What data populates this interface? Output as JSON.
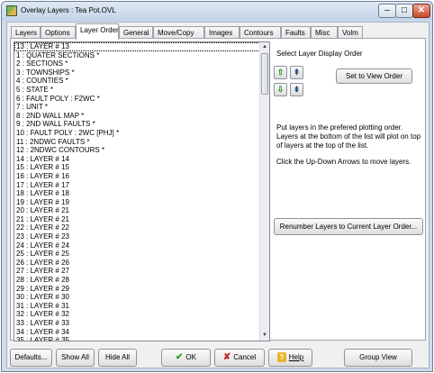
{
  "window": {
    "title": "Overlay Layers : Tea Pot.OVL",
    "minimize_glyph": "–",
    "maximize_glyph": "□",
    "close_glyph": "✕",
    "app_icon": "overlay-layers-icon"
  },
  "tabs": [
    "Layers",
    "Options",
    "Layer Order",
    "General",
    "Move/Copy",
    "Images",
    "Contours",
    "Faults",
    "Misc",
    "Volm"
  ],
  "active_tab": "Layer Order",
  "layer_list": {
    "items": [
      "13 : LAYER # 13",
      "1 : QUATER SECTIONS *",
      "2 : SECTIONS *",
      "3 : TOWNSHIPS *",
      "4 : COUNTIES *",
      "5 : STATE *",
      "6 : FAULT POLY : F2WC *",
      "7 : UNIT *",
      "8 : 2ND WALL MAP *",
      "9 : 2ND WALL FAULTS *",
      "10 : FAULT POLY : 2WC [PHJ] *",
      "11 : 2NDWC FAULTS *",
      "12 : 2NDWC CONTOURS *",
      "14 : LAYER # 14",
      "15 : LAYER # 15",
      "16 : LAYER # 16",
      "17 : LAYER # 17",
      "18 : LAYER # 18",
      "19 : LAYER # 19",
      "20 : LAYER # 21",
      "21 : LAYER # 21",
      "22 : LAYER # 22",
      "23 : LAYER # 23",
      "24 : LAYER # 24",
      "25 : LAYER # 25",
      "26 : LAYER # 26",
      "27 : LAYER # 27",
      "28 : LAYER # 28",
      "29 : LAYER # 29",
      "30 : LAYER # 30",
      "31 : LAYER # 31",
      "32 : LAYER # 32",
      "33 : LAYER # 33",
      "34 : LAYER # 34",
      "35 : LAYER # 35"
    ],
    "selected_index": 0,
    "scroll_up_glyph": "▲",
    "scroll_down_glyph": "▼"
  },
  "order_panel": {
    "heading": "Select Layer Display Order",
    "arrows": {
      "up": "⇧",
      "top": "⇞",
      "down": "⇩",
      "bottom": "⇟"
    },
    "set_view_button": "Set to View Order",
    "instructions_1": "Put layers in the prefered plotting order. Layers at the bottom of the list will plot on top of layers at the top of the list.",
    "instructions_2": "Click the Up-Down Arrows to move layers.",
    "renumber_button": "Renumber Layers to Current Layer Order..."
  },
  "bottom_buttons": {
    "defaults": "Defaults...",
    "show_all": "Show All",
    "hide_all": "Hide All",
    "ok": "OK",
    "ok_icon": "✔",
    "cancel": "Cancel",
    "cancel_icon": "✘",
    "help": "Help",
    "help_icon": "?",
    "group_view": "Group View"
  }
}
